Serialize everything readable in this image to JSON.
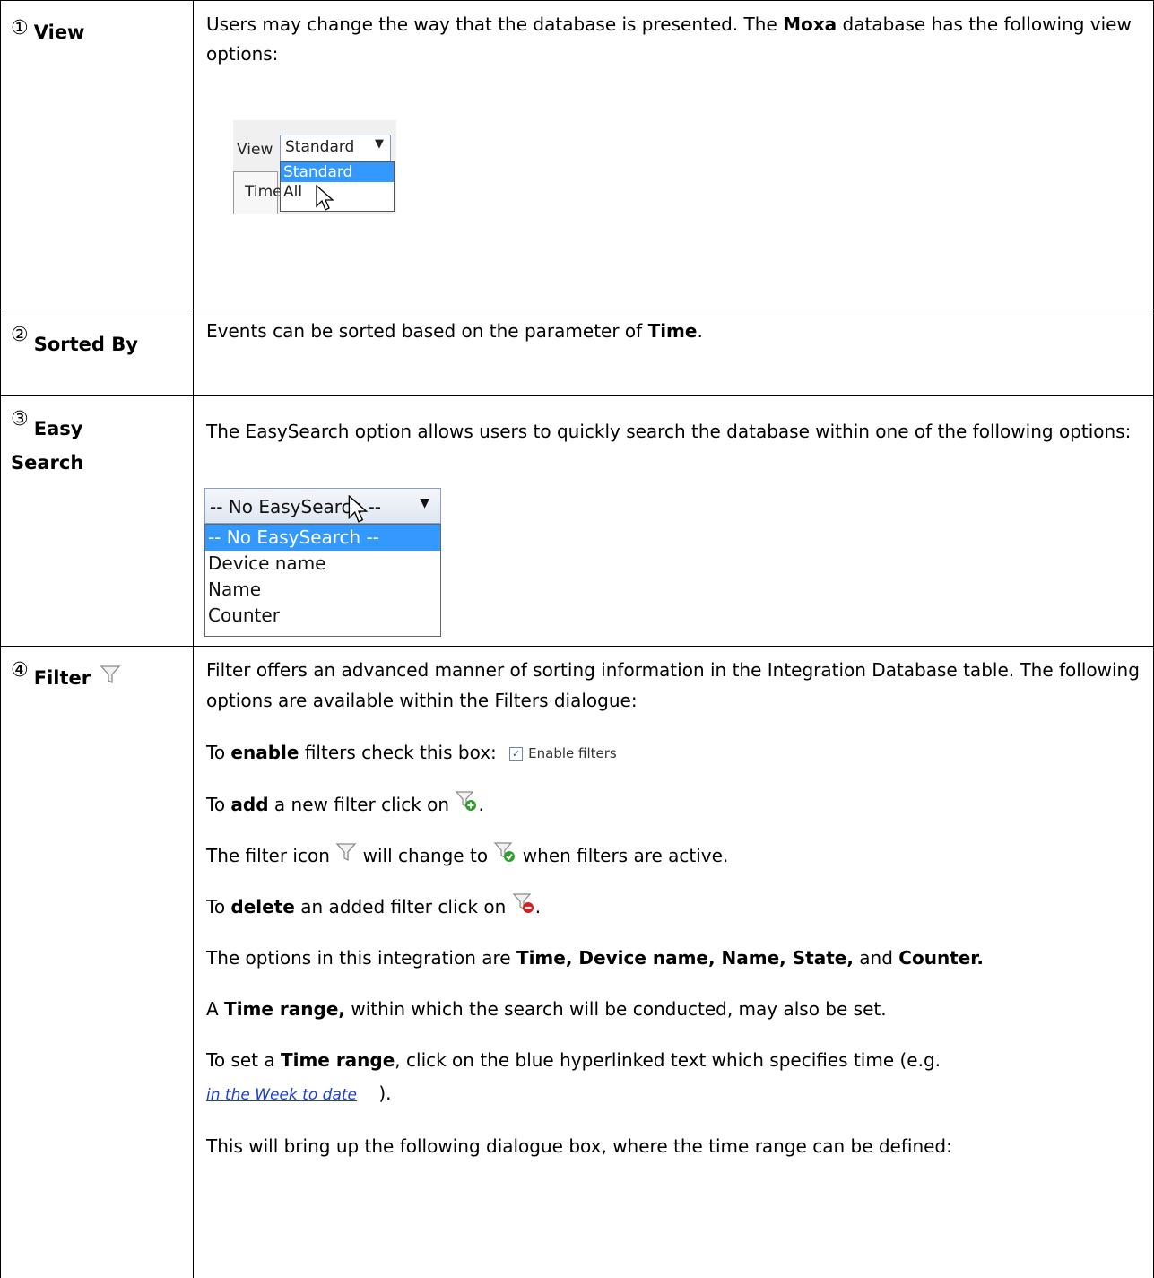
{
  "rows": [
    {
      "num": "①",
      "label": "View",
      "text": [
        "Users may change the way that the database is presented. The ",
        "Moxa",
        " database has the following view options:"
      ],
      "screenshot": {
        "label": "View",
        "selected": "Standard",
        "options": [
          "Standard",
          "All"
        ],
        "column": "Time"
      }
    },
    {
      "num": "②",
      "label": "Sorted By",
      "text": [
        "Events can be sorted based on the parameter of ",
        "Time",
        "."
      ]
    },
    {
      "num": "③",
      "label_line1": "Easy",
      "label_line2": "Search",
      "text": "The EasySearch option allows users to quickly search the database within one of the following options:",
      "screenshot": {
        "selected": "-- No EasySearch --",
        "options": [
          "-- No EasySearch --",
          "Device name",
          "Name",
          "Counter"
        ]
      }
    },
    {
      "num": "④",
      "label": "Filter",
      "intro": "Filter offers an advanced manner of sorting information in the Integration Database table. The following options are available within the Filters dialogue:",
      "enable": [
        "To ",
        "enable",
        " filters check this box:"
      ],
      "enable_checkbox_label": "Enable filters",
      "add": [
        "To ",
        "add",
        " a new filter click on",
        "."
      ],
      "icon_change": [
        "The filter icon",
        "will change to",
        "when filters are active."
      ],
      "delete": [
        "To ",
        "delete",
        " an added filter click on",
        "."
      ],
      "options": [
        "The options in this integration are ",
        "Time, Device name, Name, State,",
        " and ",
        "Counter."
      ],
      "time_range": [
        "A ",
        "Time range,",
        " within which the search will be conducted, may also be set."
      ],
      "set_range": [
        "To set a ",
        "Time range",
        ", click on the blue hyperlinked text which specifies time (e.g."
      ],
      "link_text": "in the Week to date",
      "link_close": ").",
      "dialogue": "This will bring up the following dialogue box, where the time range can be defined:"
    }
  ],
  "icons": {
    "filter": "filter-funnel-icon",
    "filter_add": "filter-add-icon",
    "filter_active": "filter-active-icon",
    "filter_delete": "filter-delete-icon"
  },
  "colors": {
    "selection": "#3399ff",
    "link": "#1a3fd6",
    "add_green": "#2e9e2e",
    "delete_red": "#d42020"
  }
}
